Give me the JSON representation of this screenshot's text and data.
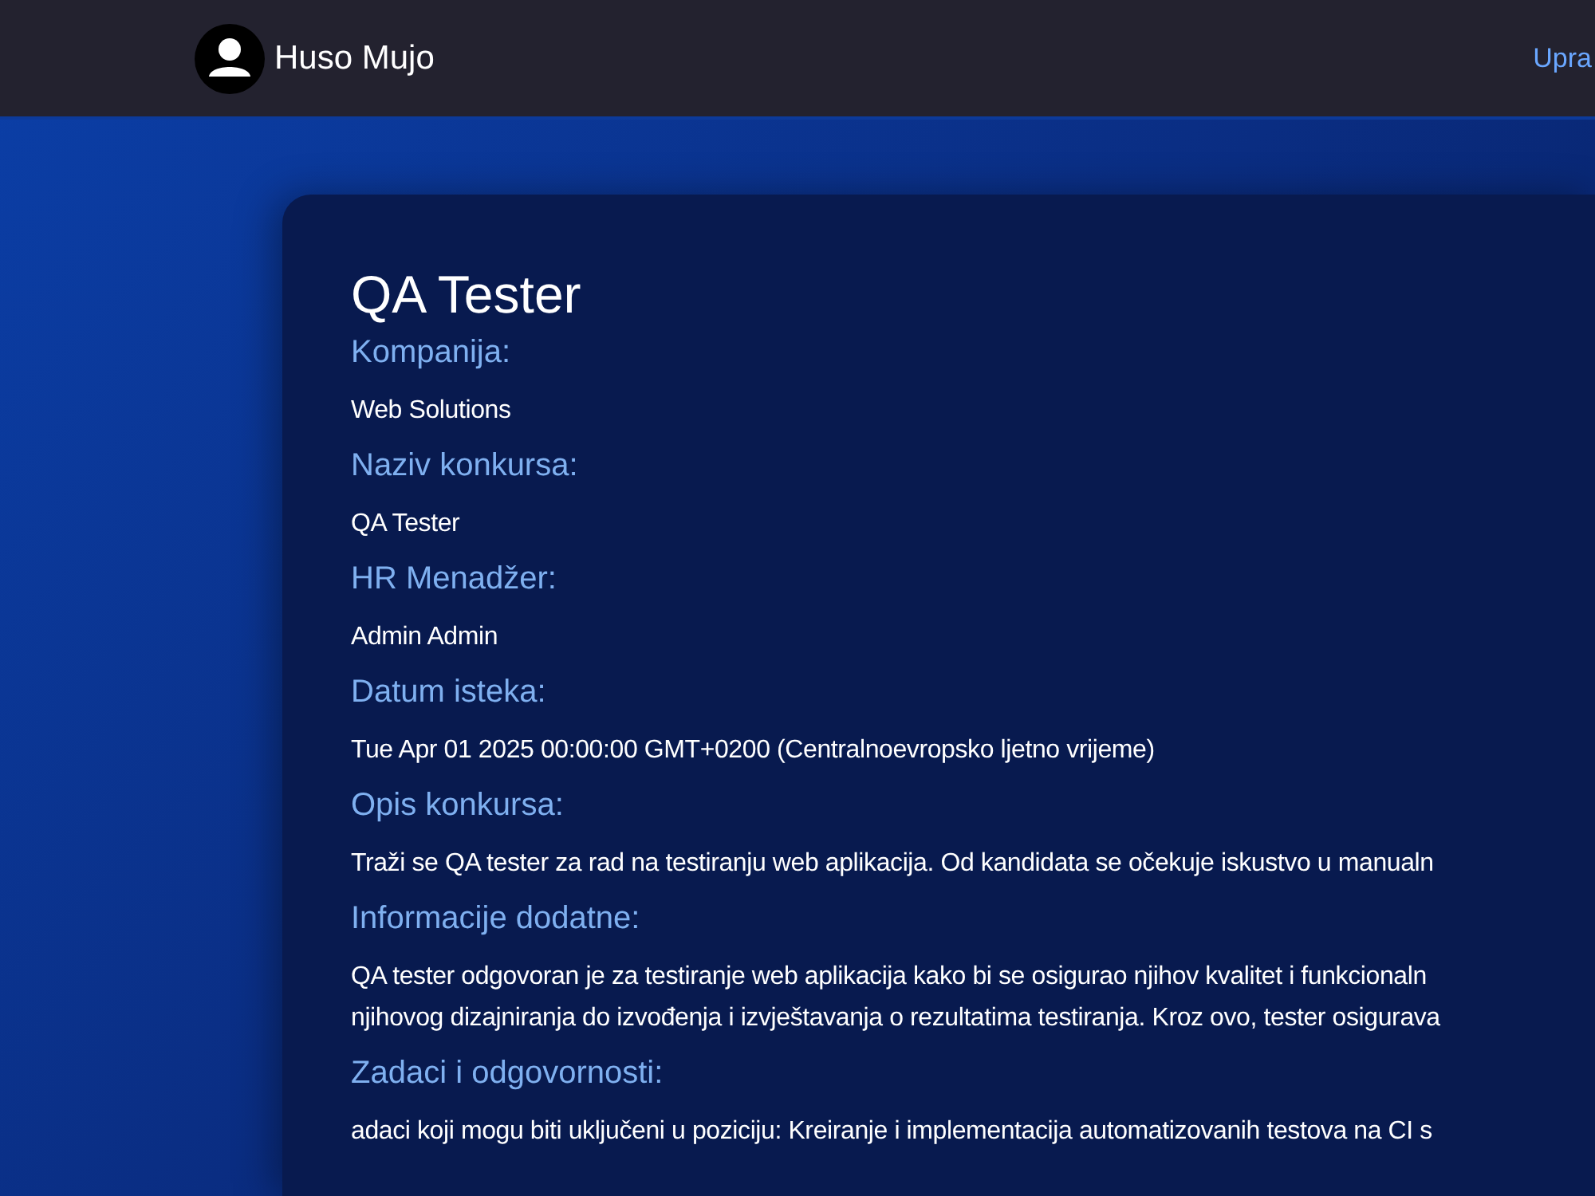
{
  "navbar": {
    "user_name": "Huso Mujo",
    "link": "Upra"
  },
  "posting": {
    "title": "QA Tester",
    "fields": [
      {
        "label": "Kompanija:",
        "lines": [
          "Web Solutions"
        ]
      },
      {
        "label": "Naziv konkursa:",
        "lines": [
          "QA Tester"
        ]
      },
      {
        "label": "HR Menadžer:",
        "lines": [
          "Admin Admin"
        ]
      },
      {
        "label": "Datum isteka:",
        "lines": [
          "Tue Apr 01 2025 00:00:00 GMT+0200 (Centralnoevropsko ljetno vrijeme)"
        ]
      },
      {
        "label": "Opis konkursa:",
        "lines": [
          "Traži se QA tester za rad na testiranju web aplikacija. Od kandidata se očekuje iskustvo u manualn"
        ]
      },
      {
        "label": "Informacije dodatne:",
        "lines": [
          "QA tester odgovoran je za testiranje web aplikacija kako bi se osigurao njihov kvalitet i funkcionaln",
          "njihovog dizajniranja do izvođenja i izvještavanja o rezultatima testiranja. Kroz ovo, tester osigurava"
        ]
      },
      {
        "label": "Zadaci i odgovornosti:",
        "lines": [
          "adaci koji mogu biti uključeni u poziciju: Kreiranje i implementacija automatizovanih testova na CI s"
        ]
      }
    ]
  }
}
